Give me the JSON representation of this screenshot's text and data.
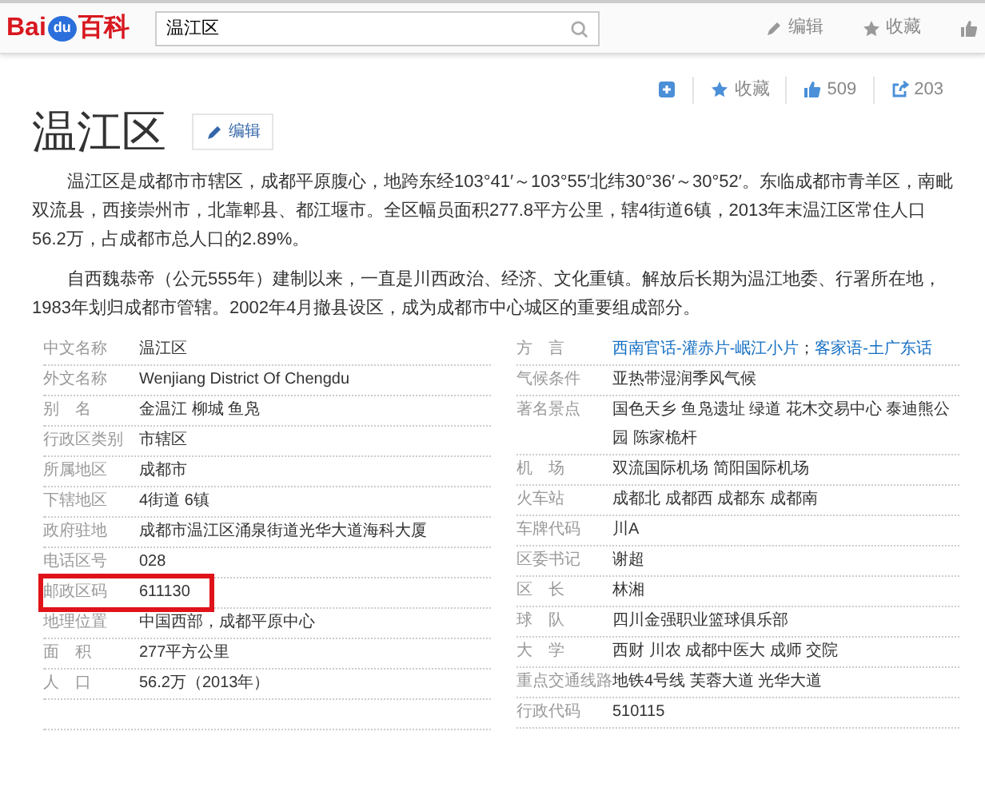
{
  "header": {
    "logo": {
      "part_1": "Bai",
      "part_2": "du",
      "part_3": "百科"
    },
    "search": {
      "value": "温江区"
    },
    "links": [
      {
        "kind": "edit",
        "label": "编辑"
      },
      {
        "kind": "star",
        "label": "收藏"
      },
      {
        "kind": "thumb"
      }
    ]
  },
  "actions": [
    {
      "kind": "plus"
    },
    {
      "kind": "star",
      "label": "收藏"
    },
    {
      "kind": "thumb",
      "label": "509"
    },
    {
      "kind": "share",
      "label": "203"
    }
  ],
  "title": "温江区",
  "edit_button": "编辑",
  "paragraphs": [
    "温江区是成都市市辖区，成都平原腹心，地跨东经103°41′～103°55′北纬30°36′～30°52′。东临成都市青羊区，南毗双流县，西接崇州市，北靠郫县、都江堰市。全区幅员面积277.8平方公里，辖4街道6镇，2013年末温江区常住人口56.2万，占成都市总人口的2.89%。",
    "自西魏恭帝（公元555年）建制以来，一直是川西政治、经济、文化重镇。解放后长期为温江地委、行署所在地，1983年划归成都市管辖。2002年4月撤县设区，成为成都市中心城区的重要组成部分。"
  ],
  "info_left": [
    {
      "label": "中文名称",
      "value": [
        {
          "text": "温江区",
          "link": false
        }
      ],
      "highlighted": false
    },
    {
      "label": "外文名称",
      "value": [
        {
          "text": "Wenjiang District Of Chengdu",
          "link": false
        }
      ],
      "highlighted": false
    },
    {
      "label": "别　名",
      "value": [
        {
          "text": "金温江 柳城 鱼凫",
          "link": false
        }
      ],
      "highlighted": false
    },
    {
      "label": "行政区类别",
      "value": [
        {
          "text": "市辖区",
          "link": false
        }
      ],
      "highlighted": false
    },
    {
      "label": "所属地区",
      "value": [
        {
          "text": "成都市",
          "link": false
        }
      ],
      "highlighted": false
    },
    {
      "label": "下辖地区",
      "value": [
        {
          "text": "4街道 6镇",
          "link": false
        }
      ],
      "highlighted": false
    },
    {
      "label": "政府驻地",
      "value": [
        {
          "text": "成都市温江区涌泉街道光华大道海科大厦",
          "link": false
        }
      ],
      "highlighted": false
    },
    {
      "label": "电话区号",
      "value": [
        {
          "text": "028",
          "link": false
        }
      ],
      "highlighted": false
    },
    {
      "label": "邮政区码",
      "value": [
        {
          "text": "611130",
          "link": false
        }
      ],
      "highlighted": true
    },
    {
      "label": "地理位置",
      "value": [
        {
          "text": "中国西部，成都平原中心",
          "link": false
        }
      ],
      "highlighted": false
    },
    {
      "label": "面　积",
      "value": [
        {
          "text": "277平方公里",
          "link": false
        }
      ],
      "highlighted": false
    },
    {
      "label": "人　口",
      "value": [
        {
          "text": "56.2万（2013年）",
          "link": false
        }
      ],
      "highlighted": false
    }
  ],
  "info_right": [
    {
      "label": "方　言",
      "value": [
        {
          "text": "西南官话-灌赤片-岷江小片",
          "link": true
        },
        {
          "text": "；",
          "link": false
        },
        {
          "text": "客家语-土广东话",
          "link": true
        }
      ],
      "highlighted": false
    },
    {
      "label": "气候条件",
      "value": [
        {
          "text": "亚热带湿润季风气候",
          "link": false
        }
      ],
      "highlighted": false
    },
    {
      "label": "著名景点",
      "value": [
        {
          "text": "国色天乡 鱼凫遗址 绿道 花木交易中心 泰迪熊公园 陈家桅杆",
          "link": false
        }
      ],
      "highlighted": false
    },
    {
      "label": "机　场",
      "value": [
        {
          "text": "双流国际机场 简阳国际机场",
          "link": false
        }
      ],
      "highlighted": false
    },
    {
      "label": "火车站",
      "value": [
        {
          "text": "成都北 成都西 成都东 成都南",
          "link": false
        }
      ],
      "highlighted": false
    },
    {
      "label": "车牌代码",
      "value": [
        {
          "text": "川A",
          "link": false
        }
      ],
      "highlighted": false
    },
    {
      "label": "区委书记",
      "value": [
        {
          "text": "谢超",
          "link": false
        }
      ],
      "highlighted": false
    },
    {
      "label": "区　长",
      "value": [
        {
          "text": "林湘",
          "link": false
        }
      ],
      "highlighted": false
    },
    {
      "label": "球　队",
      "value": [
        {
          "text": "四川金强职业篮球俱乐部",
          "link": false
        }
      ],
      "highlighted": false
    },
    {
      "label": "大　学",
      "value": [
        {
          "text": "西财 川农 成都中医大 成师 交院",
          "link": false
        }
      ],
      "highlighted": false
    },
    {
      "label": "重点交通线路",
      "value": [
        {
          "text": "地铁4号线 芙蓉大道 光华大道",
          "link": false
        }
      ],
      "highlighted": false
    },
    {
      "label": "行政代码",
      "value": [
        {
          "text": "510115",
          "link": false
        }
      ],
      "highlighted": false
    }
  ]
}
